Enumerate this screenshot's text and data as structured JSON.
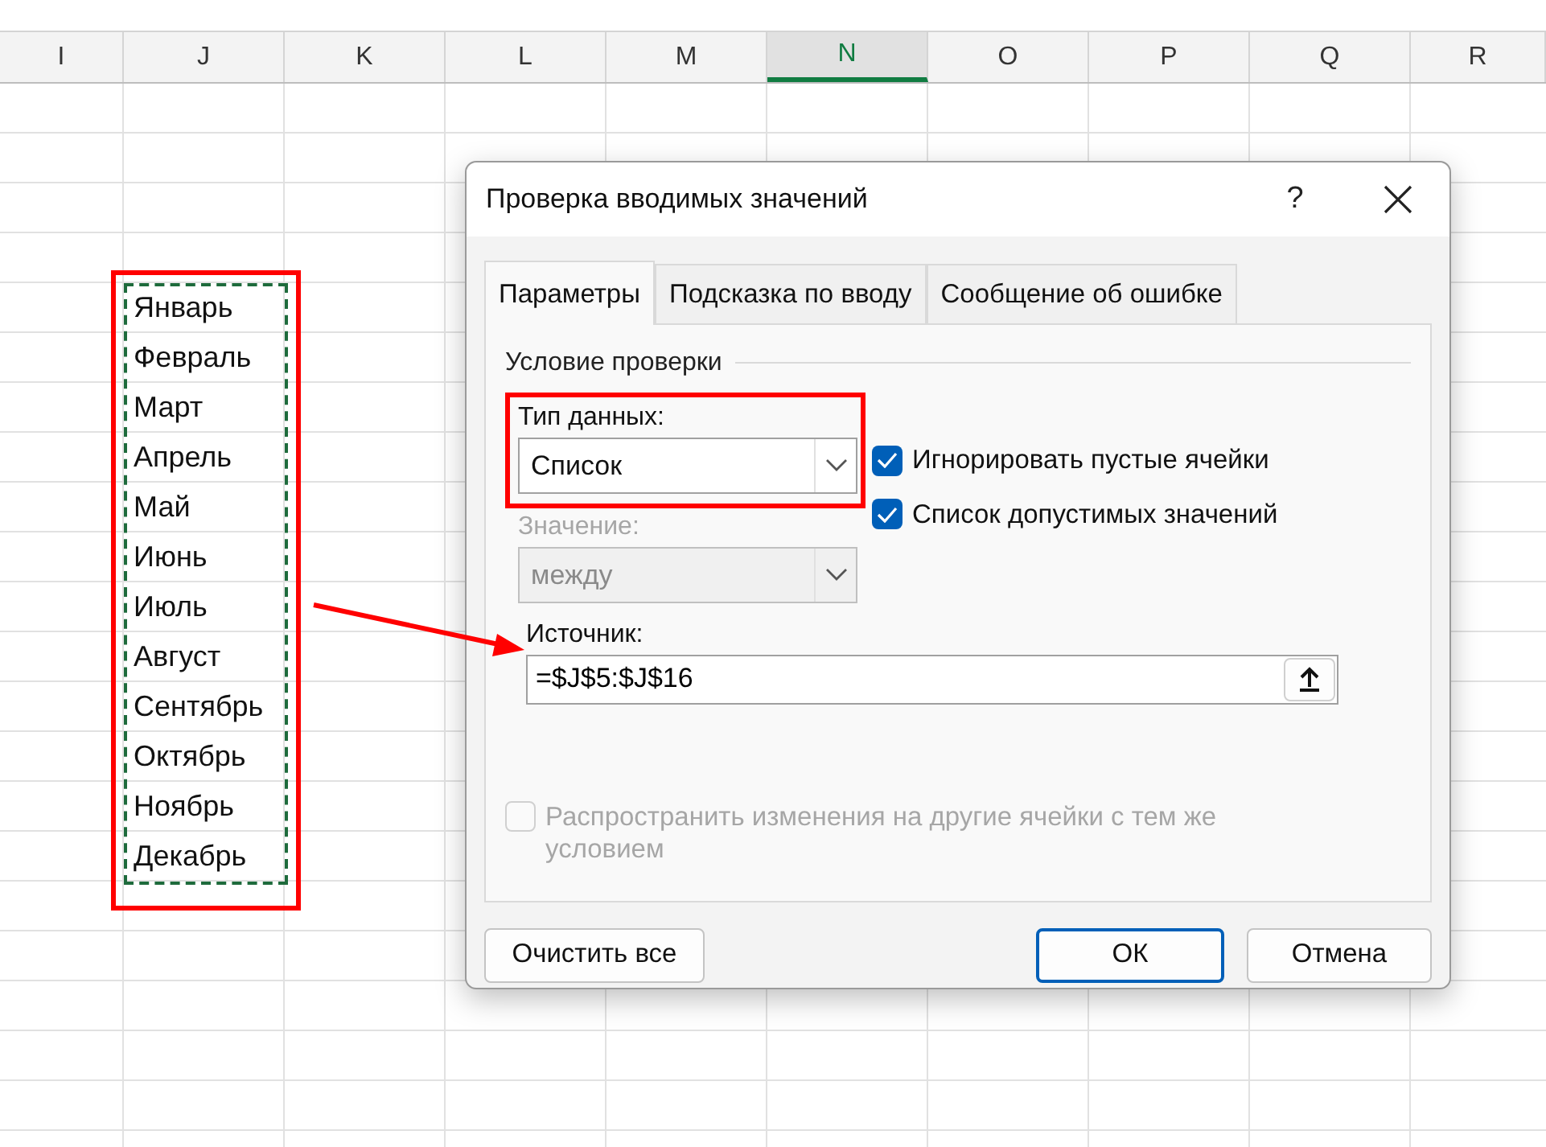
{
  "sheet": {
    "columns": [
      {
        "label": "I",
        "selected": false
      },
      {
        "label": "J",
        "selected": false
      },
      {
        "label": "K",
        "selected": false
      },
      {
        "label": "L",
        "selected": false
      },
      {
        "label": "M",
        "selected": false
      },
      {
        "label": "N",
        "selected": true
      },
      {
        "label": "O",
        "selected": false
      },
      {
        "label": "P",
        "selected": false
      },
      {
        "label": "Q",
        "selected": false
      },
      {
        "label": "R",
        "selected": false
      }
    ],
    "column_j_cells": [
      "Январь",
      "Февраль",
      "Март",
      "Апрель",
      "Май",
      "Июнь",
      "Июль",
      "Август",
      "Сентябрь",
      "Октябрь",
      "Ноябрь",
      "Декабрь"
    ]
  },
  "dialog": {
    "title": "Проверка вводимых значений",
    "help": "?",
    "tabs": [
      {
        "label": "Параметры",
        "selected": true
      },
      {
        "label": "Подсказка по вводу",
        "selected": false
      },
      {
        "label": "Сообщение об ошибке",
        "selected": false
      }
    ],
    "group_title": "Условие проверки",
    "data_type": {
      "label": "Тип данных:",
      "value": "Список",
      "disabled": false
    },
    "checkboxes": [
      {
        "label": "Игнорировать пустые ячейки",
        "checked": true
      },
      {
        "label": "Список допустимых значений",
        "checked": true
      }
    ],
    "value_field": {
      "label": "Значение:",
      "value": "между",
      "disabled": true
    },
    "source": {
      "label": "Источник:",
      "value": "=$J$5:$J$16"
    },
    "apply_all": {
      "label": "Распространить изменения на другие ячейки с тем же условием",
      "checked": false,
      "disabled": true
    },
    "buttons": [
      {
        "label": "Очистить все",
        "default": false
      },
      {
        "label": "ОК",
        "default": true
      },
      {
        "label": "Отмена",
        "default": false
      }
    ]
  }
}
